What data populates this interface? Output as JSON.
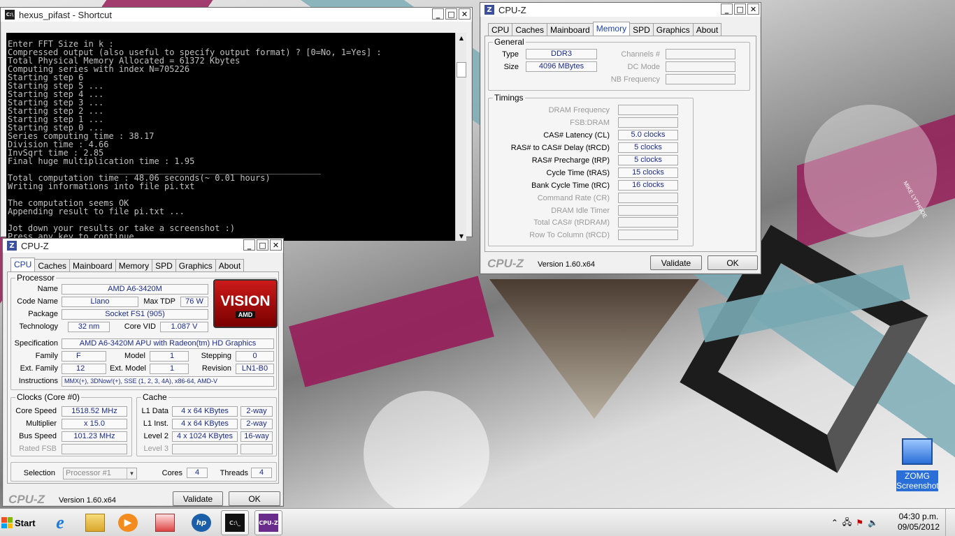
{
  "desktop": {
    "wallpaper_signature": "MIKE LYTHGOE",
    "icon_label_line1": "ZOMG",
    "icon_label_line2": "Screenshot"
  },
  "console": {
    "title": "hexus_pifast - Shortcut",
    "lines": [
      "Enter FFT Size in k :",
      "Compressed output (also useful to specify output format) ? [0=No, 1=Yes] :",
      "Total Physical Memory Allocated = 61372 Kbytes",
      "Computing series with index N=705226",
      "Starting step 6",
      "Starting step 5 ...",
      "Starting step 4 ...",
      "Starting step 3 ...",
      "Starting step 2 ...",
      "Starting step 1 ...",
      "Starting step 0 ...",
      "Series computing time : 38.17",
      "Division time : 4.66",
      "InvSqrt time : 2.85",
      "Final huge multiplication time : 1.95",
      "                    __________________________________________",
      "Total computation time : 48.06 seconds(~ 0.01 hours)",
      "Writing informations into file pi.txt",
      "",
      "The computation seems OK",
      "Appending result to file pi.txt ...",
      "",
      "Jot down your results or take a screenshot :)",
      "Press any key to continue . . ."
    ]
  },
  "cpuz_cpu": {
    "title": "CPU-Z",
    "tabs": [
      "CPU",
      "Caches",
      "Mainboard",
      "Memory",
      "SPD",
      "Graphics",
      "About"
    ],
    "processor_group": "Processor",
    "name_label": "Name",
    "name": "AMD A6-3420M",
    "codename_label": "Code Name",
    "codename": "Llano",
    "maxtdp_label": "Max TDP",
    "maxtdp": "76 W",
    "package_label": "Package",
    "package": "Socket FS1 (905)",
    "technology_label": "Technology",
    "technology": "32 nm",
    "corevid_label": "Core VID",
    "corevid": "1.087 V",
    "spec_label": "Specification",
    "spec": "AMD A6-3420M APU with Radeon(tm) HD Graphics",
    "family_label": "Family",
    "family": "F",
    "model_label": "Model",
    "model": "1",
    "stepping_label": "Stepping",
    "stepping": "0",
    "extfamily_label": "Ext. Family",
    "extfamily": "12",
    "extmodel_label": "Ext. Model",
    "extmodel": "1",
    "revision_label": "Revision",
    "revision": "LN1-B0",
    "instructions_label": "Instructions",
    "instructions": "MMX(+), 3DNow!(+), SSE (1, 2, 3, 4A), x86-64, AMD-V",
    "logo_line1": "VISION",
    "logo_line2": "AMD",
    "clocks_group": "Clocks (Core #0)",
    "corespeed_label": "Core Speed",
    "corespeed": "1518.52 MHz",
    "multiplier_label": "Multiplier",
    "multiplier": "x 15.0",
    "busspeed_label": "Bus Speed",
    "busspeed": "101.23 MHz",
    "ratedfsb_label": "Rated FSB",
    "cache_group": "Cache",
    "l1data_label": "L1 Data",
    "l1data": "4 x 64 KBytes",
    "l1data_way": "2-way",
    "l1inst_label": "L1 Inst.",
    "l1inst": "4 x 64 KBytes",
    "l1inst_way": "2-way",
    "level2_label": "Level 2",
    "level2": "4 x 1024 KBytes",
    "level2_way": "16-way",
    "level3_label": "Level 3",
    "selection_label": "Selection",
    "selection": "Processor #1",
    "cores_label": "Cores",
    "cores": "4",
    "threads_label": "Threads",
    "threads": "4",
    "brand": "CPU-Z",
    "version": "Version 1.60.x64",
    "validate": "Validate",
    "ok": "OK"
  },
  "cpuz_mem": {
    "title": "CPU-Z",
    "tabs": [
      "CPU",
      "Caches",
      "Mainboard",
      "Memory",
      "SPD",
      "Graphics",
      "About"
    ],
    "general_group": "General",
    "type_label": "Type",
    "type": "DDR3",
    "size_label": "Size",
    "size": "4096 MBytes",
    "channels_label": "Channels #",
    "dcmode_label": "DC Mode",
    "nbfreq_label": "NB Frequency",
    "timings_group": "Timings",
    "dramfreq_label": "DRAM Frequency",
    "fsbdram_label": "FSB:DRAM",
    "cas_label": "CAS# Latency (CL)",
    "cas": "5.0 clocks",
    "trcd_label": "RAS# to CAS# Delay (tRCD)",
    "trcd": "5 clocks",
    "trp_label": "RAS# Precharge (tRP)",
    "trp": "5 clocks",
    "tras_label": "Cycle Time (tRAS)",
    "tras": "15 clocks",
    "trc_label": "Bank Cycle Time (tRC)",
    "trc": "16 clocks",
    "cr_label": "Command Rate (CR)",
    "idle_label": "DRAM Idle Timer",
    "trdram_label": "Total CAS# (tRDRAM)",
    "trcd2_label": "Row To Column (tRCD)",
    "brand": "CPU-Z",
    "version": "Version 1.60.x64",
    "validate": "Validate",
    "ok": "OK"
  },
  "taskbar": {
    "start": "Start",
    "time": "04:30 p.m.",
    "date": "09/05/2012"
  }
}
